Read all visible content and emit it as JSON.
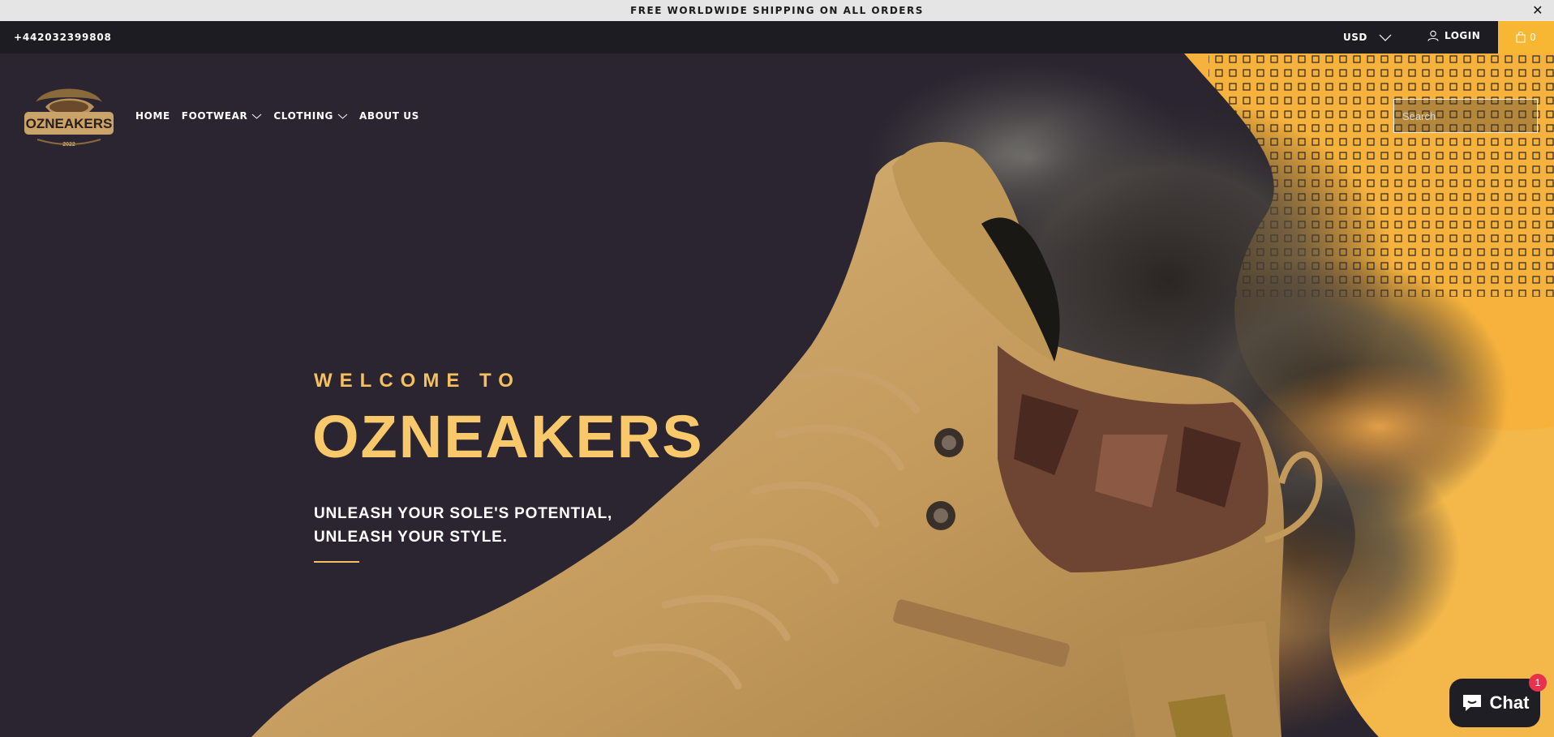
{
  "announcement": {
    "text": "FREE WORLDWIDE SHIPPING ON ALL ORDERS",
    "close": "✕"
  },
  "topbar": {
    "phone": "+442032399808",
    "currency": "USD",
    "login": "LOGIN",
    "cart_count": "0"
  },
  "logo": {
    "text": "OZNEAKERS",
    "year": "2022"
  },
  "nav": [
    {
      "label": "HOME",
      "has_dropdown": false
    },
    {
      "label": "FOOTWEAR",
      "has_dropdown": true
    },
    {
      "label": "CLOTHING",
      "has_dropdown": true
    },
    {
      "label": "ABOUT US",
      "has_dropdown": false
    }
  ],
  "search": {
    "placeholder": "Search"
  },
  "hero": {
    "eyebrow": "WELCOME TO",
    "title": "OZNEAKERS",
    "tagline_line1": "UNLEASH YOUR SOLE'S POTENTIAL,",
    "tagline_line2": "UNLEASH YOUR STYLE."
  },
  "chat": {
    "label": "Chat",
    "badge": "1"
  },
  "colors": {
    "accent": "#f5c05e",
    "cart_bg": "#f7b733",
    "hero_bg": "#2a2530",
    "topbar_bg": "#1c1c22",
    "badge": "#e8324d"
  },
  "icons": [
    "close-icon",
    "chevron-down-icon",
    "user-icon",
    "bag-icon",
    "search-icon",
    "chat-icon"
  ]
}
